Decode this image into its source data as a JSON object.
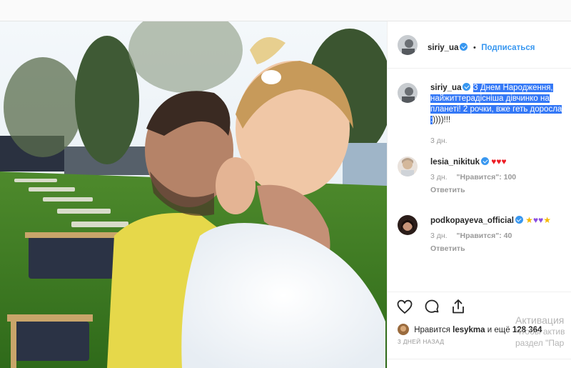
{
  "post": {
    "username": "siriy_ua",
    "separator": "•",
    "follow_label": "Подписаться"
  },
  "caption": {
    "username": "siriy_ua",
    "highlighted_text": "З Днем Народження, найжиттерадісніша дівчинко на планеті! 2 рочки, вже геть доросла :",
    "tail_text": "))))!!!",
    "time": "3 дн."
  },
  "comments": [
    {
      "username": "lesia_nikituk",
      "emoji": [
        "heart",
        "heart",
        "heart"
      ],
      "time": "3 дн.",
      "likes": "\"Нравится\": 100",
      "reply": "Ответить"
    },
    {
      "username": "podkopayeva_official",
      "emoji": [
        "star",
        "purple-heart",
        "purple-heart",
        "star"
      ],
      "time": "3 дн.",
      "likes": "\"Нравится\": 40",
      "reply": "Ответить"
    }
  ],
  "likes": {
    "prefix": "Нравится",
    "user": "lesykma",
    "middle": "и ещё",
    "count": "128 364"
  },
  "date_label": "3 ДНЕЙ НАЗАД",
  "windows_activation": {
    "line1": "Активация",
    "line2": "Чтобы актив",
    "line3": "раздел \"Пар"
  },
  "colors": {
    "accent": "#3897f0",
    "highlight": "#3478f6",
    "heart": "#ed1c24"
  }
}
